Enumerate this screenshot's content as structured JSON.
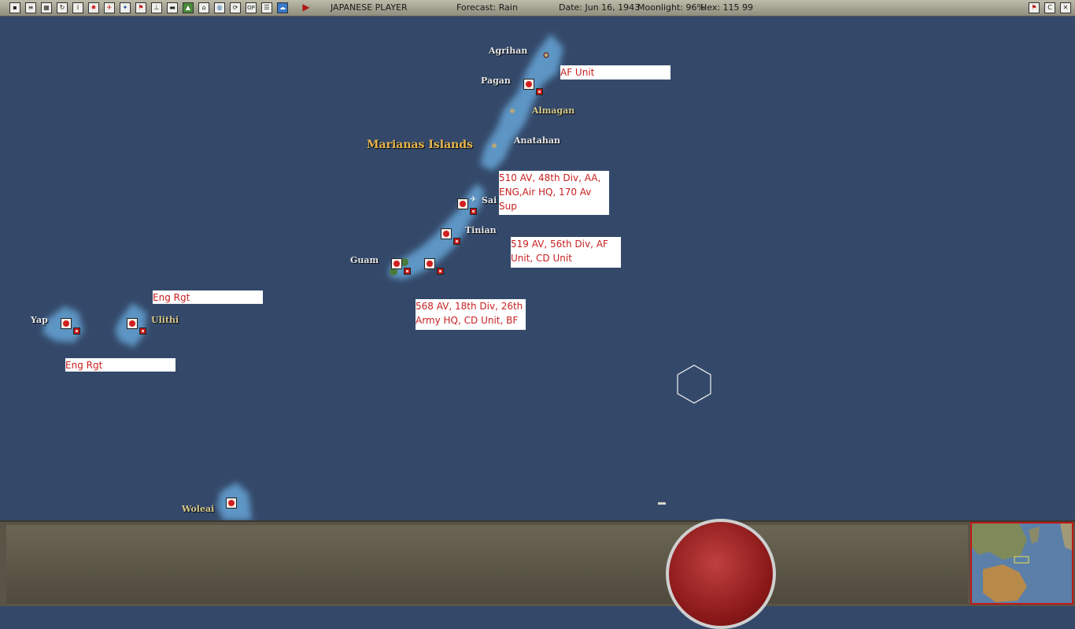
{
  "toolbar": {
    "left_buttons": [
      "menu-icon",
      "document-icon",
      "calendar-icon",
      "refresh-icon",
      "info-icon",
      "rising-sun-icon",
      "aircraft-icon",
      "ship-icon",
      "flag-icon",
      "airfield-icon",
      "truck-icon",
      "terrain-icon",
      "base-icon",
      "globe-icon",
      "cycle-icon",
      "op-icon",
      "report-icon",
      "cloud-icon"
    ],
    "op_label": "OP",
    "info_label": "i",
    "player": "JAPANESE PLAYER",
    "forecast": "Forecast: Rain",
    "date": "Date: Jun 16, 1943",
    "moonlight": "Moonlight: 96%",
    "hex": "Hex: 115 99",
    "right_buttons": [
      "flag-red-icon",
      "c-icon",
      "close-icon"
    ],
    "c_label": "C",
    "close_label": "✕"
  },
  "map": {
    "region": "Marianas Islands",
    "islands": {
      "agrihan": "Agrihan",
      "pagan": "Pagan",
      "almagan": "Almagan",
      "anatahan": "Anatahan",
      "saipan": "Sai",
      "tinian": "Tinian",
      "guam": "Guam",
      "yap": "Yap",
      "ulithi": "Ulithi",
      "woleai": "Woleai"
    },
    "notes": {
      "pagan": "AF Unit",
      "saipan": "510 AV, 48th Div, AA, ENG,Air HQ, 170 Av Sup",
      "tinian": "519 AV, 56th Div, AF Unit, CD Unit",
      "guam": "568 AV, 18th Div, 26th Army HQ, CD Unit, BF",
      "ulithi": "Eng Rgt",
      "yap": "Eng Rgt"
    }
  },
  "colors": {
    "ocean": "#34496a",
    "shallows": "#5d95c4",
    "japan_red": "#d21e1e",
    "note_text": "#c82020"
  }
}
